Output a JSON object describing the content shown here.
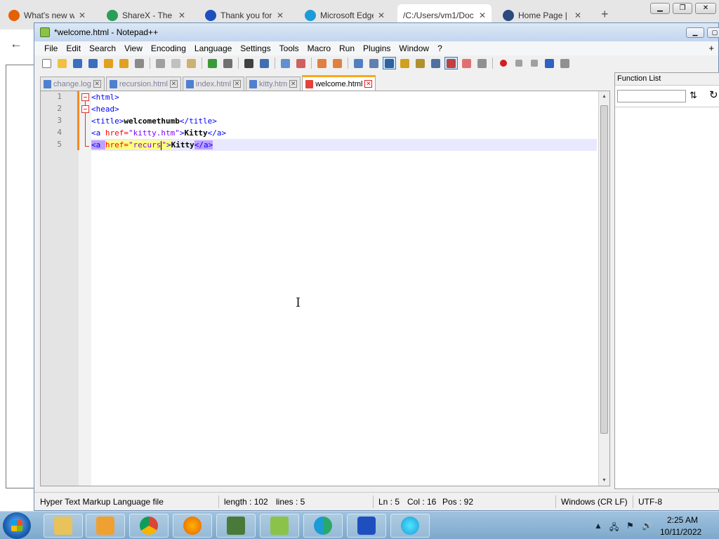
{
  "browser": {
    "tabs": [
      {
        "label": "What's new wit",
        "color": "#e66000"
      },
      {
        "label": "ShareX - The be",
        "color": "#2a9d5a"
      },
      {
        "label": "Thank you for d",
        "color": "#1f4fbf"
      },
      {
        "label": "Microsoft Edge",
        "color": "#1c9bd6"
      },
      {
        "label": "/C:/Users/vm1/Doc",
        "color": "#777777"
      },
      {
        "label": "Home Page | Se",
        "color": "#2b4a7f"
      }
    ],
    "tab_close": "✕",
    "new_tab": "+"
  },
  "npp": {
    "title": "*welcome.html - Notepad++",
    "menu": [
      "File",
      "Edit",
      "Search",
      "View",
      "Encoding",
      "Language",
      "Settings",
      "Tools",
      "Macro",
      "Run",
      "Plugins",
      "Window",
      "?"
    ],
    "menu_plus": "+",
    "file_tabs": [
      {
        "label": "change.log",
        "active": false
      },
      {
        "label": "recursion.html",
        "active": false
      },
      {
        "label": "index.html",
        "active": false
      },
      {
        "label": "kitty.htm",
        "active": false
      },
      {
        "label": "welcome.html",
        "active": true
      }
    ],
    "line_numbers": [
      "1",
      "2",
      "3",
      "4",
      "5"
    ],
    "code": {
      "l1_tag": "<html>",
      "l2_tag": "<head>",
      "l3_open": "<title>",
      "l3_text": "welcomethumb",
      "l3_close": "</title>",
      "l4_open": "<a ",
      "l4_attr": "href=",
      "l4_val": "\"kitty.htm\"",
      "l4_gt": ">",
      "l4_text": "Kitty",
      "l4_close": "</a>",
      "l5_open": "<a",
      "l5_sp": " ",
      "l5_attr": "href=",
      "l5_val_a": "\"recurs",
      "l5_val_b": "\"",
      "l5_gt": ">",
      "l5_text": "Kitty",
      "l5_close": "</a>"
    },
    "function_list": {
      "title": "Function List",
      "sort_icon": "⇅",
      "reload_icon": "↻"
    },
    "status": {
      "file_type": "Hyper Text Markup Language file",
      "length": "length : 102",
      "lines": "lines : 5",
      "ln": "Ln : 5",
      "col": "Col : 16",
      "pos": "Pos : 92",
      "eol": "Windows (CR LF)",
      "encoding": "UTF-8"
    }
  },
  "taskbar": {
    "apps": [
      {
        "name": "explorer",
        "color": "#e8c25a"
      },
      {
        "name": "media-player",
        "color": "#f0a030"
      },
      {
        "name": "chrome",
        "color": "#db4437"
      },
      {
        "name": "firefox",
        "color": "#e66000"
      },
      {
        "name": "task-manager",
        "color": "#4a7a3a"
      },
      {
        "name": "notepadpp",
        "color": "#8bc34a"
      },
      {
        "name": "edge-dev",
        "color": "#2aa86a"
      },
      {
        "name": "malwarebytes",
        "color": "#1f4fbf"
      },
      {
        "name": "edge",
        "color": "#1c9bd6"
      }
    ],
    "time": "2:25 AM",
    "date": "10/11/2022"
  }
}
